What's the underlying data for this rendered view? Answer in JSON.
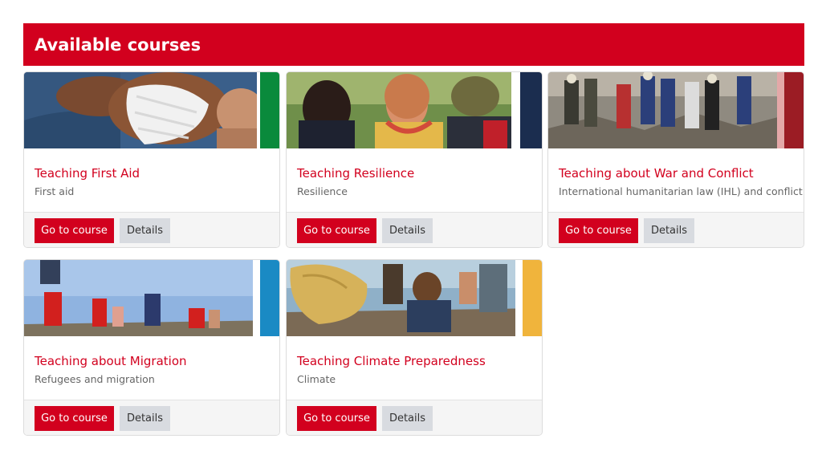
{
  "header": {
    "title": "Available courses"
  },
  "courses": [
    {
      "title": "Teaching First Aid",
      "subtitle": "First aid",
      "accent": "#0a8a3c",
      "image": "bandage-arm-photo",
      "go_label": "Go to course",
      "details_label": "Details"
    },
    {
      "title": "Teaching Resilience",
      "subtitle": "Resilience",
      "accent": "#1b2d4f",
      "image": "students-outdoors-photo",
      "go_label": "Go to course",
      "details_label": "Details"
    },
    {
      "title": "Teaching about War and Conflict",
      "subtitle": "International humanitarian law (IHL) and conflict",
      "accent": "#9b1c24",
      "image": "rescue-workers-rubble-photo",
      "go_label": "Go to course",
      "details_label": "Details"
    },
    {
      "title": "Teaching about Migration",
      "subtitle": "Refugees and migration",
      "accent": "#1a8ac4",
      "image": "migrants-walking-photo",
      "go_label": "Go to course",
      "details_label": "Details"
    },
    {
      "title": "Teaching Climate Preparedness",
      "subtitle": "Climate",
      "accent": "#f0b43c",
      "image": "beach-cleanup-photo",
      "go_label": "Go to course",
      "details_label": "Details"
    }
  ],
  "colors": {
    "brand": "#d2001e",
    "secondary_button": "#d8dbe0"
  }
}
